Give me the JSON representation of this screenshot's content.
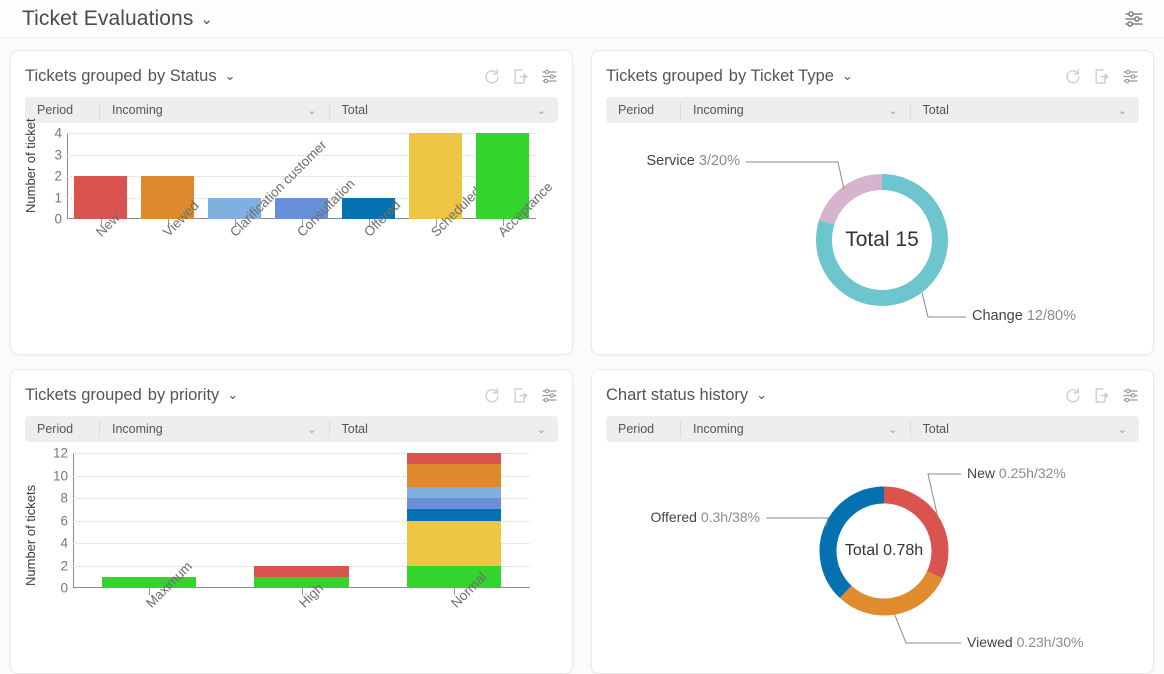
{
  "header": {
    "title": "Ticket Evaluations",
    "chevron": "⌄",
    "settings_icon": "sliders-icon"
  },
  "common": {
    "filter": {
      "period_label": "Period",
      "incoming_value": "Incoming",
      "total_value": "Total",
      "chevron": "⌄"
    },
    "actions": {
      "refresh": "refresh-icon",
      "export": "export-icon",
      "settings": "sliders-icon"
    }
  },
  "panels": [
    {
      "id": "tickets-by-status",
      "title_main": "Tickets grouped",
      "title_sub": "by Status",
      "chevron": "⌄"
    },
    {
      "id": "tickets-by-ticket-type",
      "title_main": "Tickets grouped",
      "title_sub": "by Ticket Type",
      "chevron": "⌄"
    },
    {
      "id": "tickets-by-priority",
      "title_main": "Tickets grouped",
      "title_sub": "by priority",
      "chevron": "⌄"
    },
    {
      "id": "chart-status-history",
      "title_main": "Chart status history",
      "title_sub": "",
      "chevron": "⌄"
    }
  ],
  "chart_data": [
    {
      "type": "bar",
      "id": "tickets-by-status",
      "title": "Tickets grouped by Status",
      "categories": [
        "New",
        "Viewed",
        "Clarification customer",
        "Consultation",
        "Offered",
        "Scheduled",
        "Acceptance"
      ],
      "values": [
        2,
        2,
        1,
        1,
        1,
        4,
        4
      ],
      "colors": [
        "#d9534f",
        "#de8a2c",
        "#7fb0e0",
        "#6690d8",
        "#0571b0",
        "#eec643",
        "#33d42b"
      ],
      "xlabel": "",
      "ylabel": "Number of ticket",
      "ylim": [
        0,
        4
      ],
      "yticks": [
        0,
        1,
        2,
        3,
        4
      ],
      "grid": true,
      "legend": "none"
    },
    {
      "type": "pie",
      "id": "tickets-by-ticket-type",
      "title": "Tickets grouped by Ticket Type",
      "center_label": "Total 15",
      "total": 15,
      "unit": "",
      "slices": [
        {
          "name": "Change",
          "value": 12,
          "percent": 80,
          "label": "Change",
          "value_text": "12/80%",
          "color": "#6dc5ce"
        },
        {
          "name": "Service",
          "value": 3,
          "percent": 20,
          "label": "Service",
          "value_text": "3/20%",
          "color": "#d6b4cd"
        }
      ],
      "legend": "callouts"
    },
    {
      "type": "bar",
      "id": "tickets-by-priority",
      "title": "Tickets grouped by priority",
      "stacked": true,
      "categories": [
        "Maximum",
        "High",
        "Normal"
      ],
      "series": [
        {
          "name": "green",
          "color": "#33d42b",
          "values": [
            1,
            1,
            2
          ]
        },
        {
          "name": "yellow",
          "color": "#eec643",
          "values": [
            0,
            0,
            4
          ]
        },
        {
          "name": "dark-blue",
          "color": "#0571b0",
          "values": [
            0,
            0,
            1
          ]
        },
        {
          "name": "medium-blue",
          "color": "#6690d8",
          "values": [
            0,
            0,
            1
          ]
        },
        {
          "name": "light-blue",
          "color": "#7fb0e0",
          "values": [
            0,
            0,
            1
          ]
        },
        {
          "name": "orange",
          "color": "#de8a2c",
          "values": [
            0,
            0,
            2
          ]
        },
        {
          "name": "red",
          "color": "#d9534f",
          "values": [
            0,
            1,
            1
          ]
        }
      ],
      "totals": [
        1,
        2,
        12
      ],
      "xlabel": "",
      "ylabel": "Number of tickets",
      "ylim": [
        0,
        12
      ],
      "yticks": [
        0,
        2,
        4,
        6,
        8,
        10,
        12
      ],
      "grid": true,
      "legend": "none"
    },
    {
      "type": "pie",
      "id": "chart-status-history",
      "title": "Chart status history",
      "center_label": "Total 0.78h",
      "total": 0.78,
      "unit": "h",
      "slices": [
        {
          "name": "New",
          "value": 0.25,
          "percent": 32,
          "label": "New",
          "value_text": "0.25h/32%",
          "color": "#d9534f"
        },
        {
          "name": "Viewed",
          "value": 0.23,
          "percent": 30,
          "label": "Viewed",
          "value_text": "0.23h/30%",
          "color": "#e08c2e"
        },
        {
          "name": "Offered",
          "value": 0.3,
          "percent": 38,
          "label": "Offered",
          "value_text": "0.3h/38%",
          "color": "#0571b0"
        }
      ],
      "legend": "callouts"
    }
  ]
}
